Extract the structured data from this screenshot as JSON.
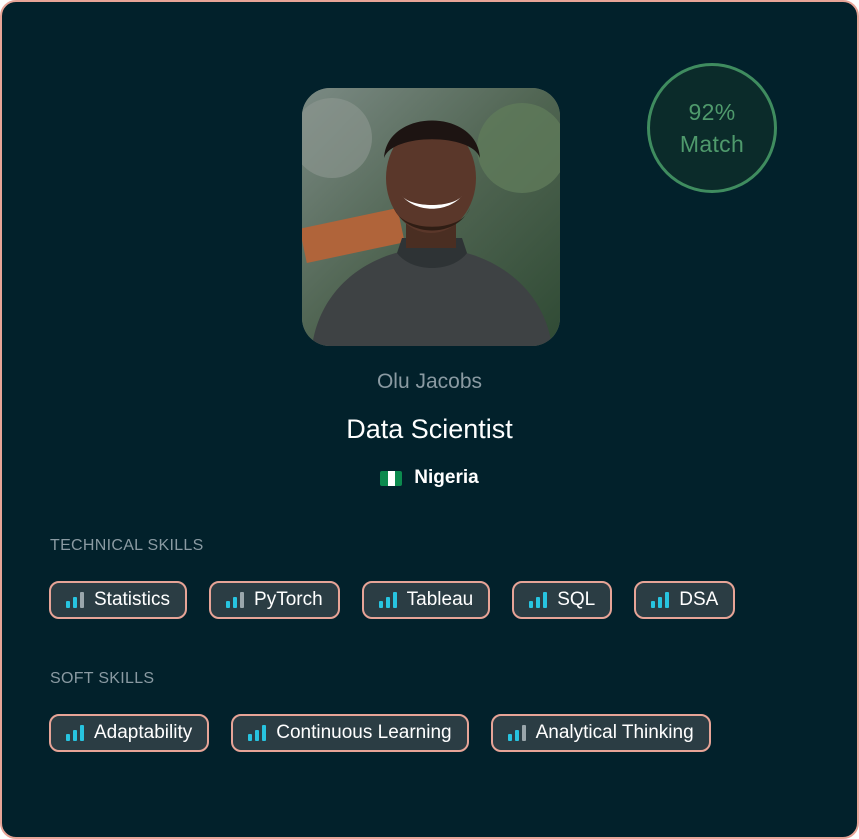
{
  "candidate": {
    "name": "Olu Jacobs",
    "role": "Data Scientist",
    "country": "Nigeria",
    "flag_icon": "nigeria-flag-icon"
  },
  "match": {
    "percent": "92%",
    "label": "Match",
    "color": "#4f9a6c"
  },
  "technical_skills": {
    "title": "TECHNICAL SKILLS",
    "items": [
      {
        "label": "Statistics",
        "level": 2
      },
      {
        "label": "PyTorch",
        "level": 2
      },
      {
        "label": "Tableau",
        "level": 3
      },
      {
        "label": "SQL",
        "level": 3
      },
      {
        "label": "DSA",
        "level": 3
      }
    ]
  },
  "soft_skills": {
    "title": "SOFT SKILLS",
    "items": [
      {
        "label": "Adaptability",
        "level": 3
      },
      {
        "label": "Continuous Learning",
        "level": 3
      },
      {
        "label": "Analytical Thinking",
        "level": 2
      }
    ]
  },
  "colors": {
    "background": "#02212b",
    "accent_border": "#e7a497",
    "skill_bar": "#27c4e0",
    "match_ring": "#3f8c5f"
  }
}
